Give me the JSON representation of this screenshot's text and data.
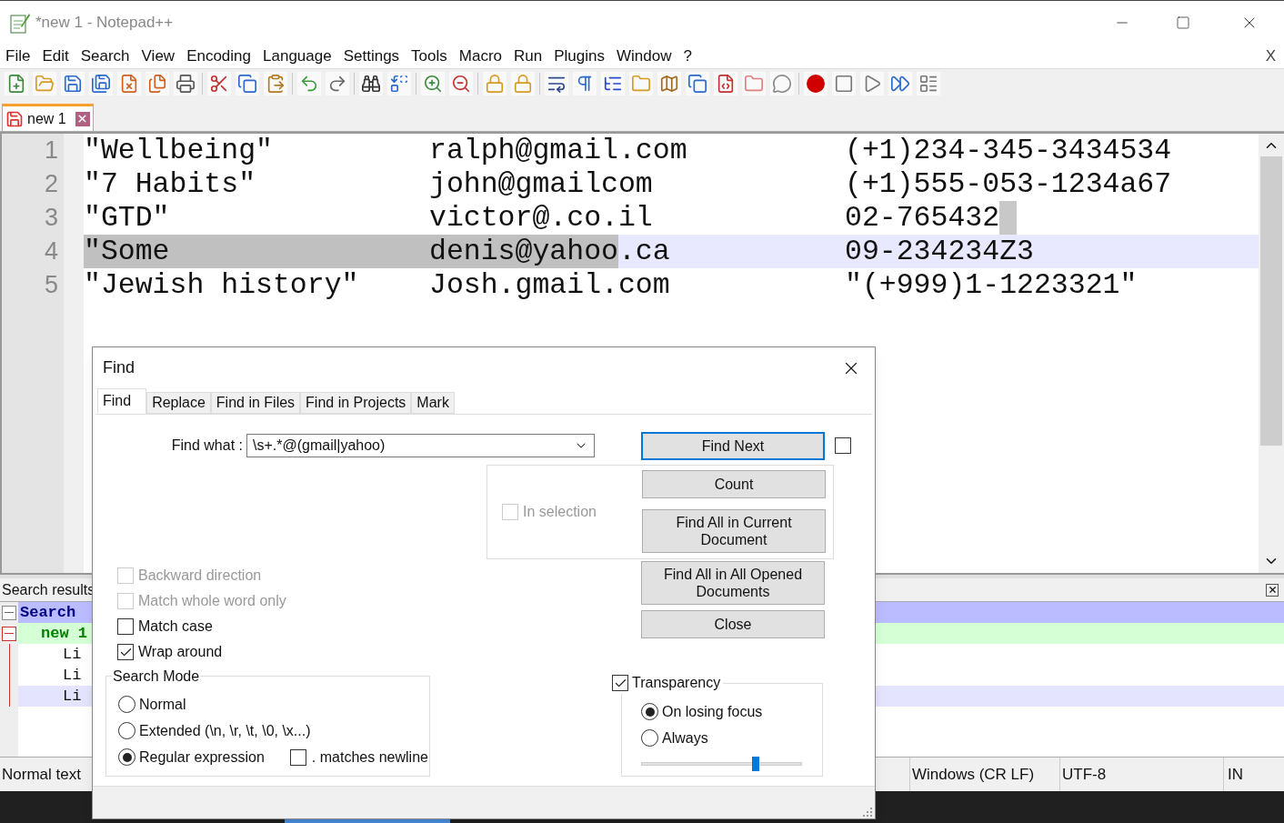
{
  "window": {
    "title": "*new 1 - Notepad++"
  },
  "menu": [
    "File",
    "Edit",
    "Search",
    "View",
    "Encoding",
    "Language",
    "Settings",
    "Tools",
    "Macro",
    "Run",
    "Plugins",
    "Window",
    "?"
  ],
  "menu_close": "X",
  "doc_tabs": [
    {
      "label": "new 1",
      "selected": true
    }
  ],
  "editor": {
    "lines": [
      {
        "number": "1",
        "current": false,
        "block_cursor": false,
        "cells": [
          [
            {
              "text": "\"Wellbeing\"",
              "selected": false
            }
          ],
          [
            {
              "text": "ralph@gmail.com",
              "selected": false
            }
          ],
          [
            {
              "text": "(+1)234-345-3434534",
              "selected": false
            }
          ]
        ]
      },
      {
        "number": "2",
        "current": false,
        "block_cursor": false,
        "cells": [
          [
            {
              "text": "\"7 Habits\"",
              "selected": false
            }
          ],
          [
            {
              "text": "john@gmailcom",
              "selected": false
            }
          ],
          [
            {
              "text": "(+1)555-053-1234a67",
              "selected": false
            }
          ]
        ]
      },
      {
        "number": "3",
        "current": false,
        "block_cursor": true,
        "cells": [
          [
            {
              "text": "\"GTD\"",
              "selected": false
            }
          ],
          [
            {
              "text": "victor@.co.il",
              "selected": false
            }
          ],
          [
            {
              "text": "02-765432",
              "selected": false
            }
          ]
        ]
      },
      {
        "number": "4",
        "current": true,
        "block_cursor": false,
        "cells": [
          [
            {
              "text": "\"Some",
              "selected": true
            }
          ],
          [
            {
              "text": "denis@yahoo",
              "selected": true
            },
            {
              "text": ".ca",
              "selected": false
            }
          ],
          [
            {
              "text": "09-234234Z3",
              "selected": false
            }
          ]
        ]
      },
      {
        "number": "5",
        "current": false,
        "block_cursor": false,
        "cells": [
          [
            {
              "text": "\"Jewish history\"",
              "selected": false
            }
          ],
          [
            {
              "text": "Josh.gmail.com",
              "selected": false
            }
          ],
          [
            {
              "text": "\"(+999)1-1223321\"",
              "selected": false
            }
          ]
        ]
      }
    ]
  },
  "search_results": {
    "title": "Search results",
    "rows": [
      {
        "kind": "search",
        "text": "Search",
        "expanded": true,
        "current": false
      },
      {
        "kind": "file",
        "text": "new 1",
        "expanded": true,
        "current": false
      },
      {
        "kind": "line",
        "text": "Li",
        "current": false
      },
      {
        "kind": "line",
        "text": "Li",
        "current": false
      },
      {
        "kind": "line",
        "text": "Li",
        "current": true
      }
    ]
  },
  "status_bar": [
    "Normal text",
    "Windows (CR LF)",
    "UTF-8",
    "IN"
  ],
  "find_dialog": {
    "title": "Find",
    "tabs": [
      {
        "label": "Find",
        "selected": true
      },
      {
        "label": "Replace",
        "selected": false
      },
      {
        "label": "Find in Files",
        "selected": false
      },
      {
        "label": "Find in Projects",
        "selected": false
      },
      {
        "label": "Mark",
        "selected": false
      }
    ],
    "find_what": {
      "label": "Find what :",
      "value": "\\s+.*@(gmail|yahoo)"
    },
    "find_next": {
      "label": "Find Next",
      "focused": true
    },
    "find_next_option": {
      "checked": false
    },
    "in_selection": {
      "label": "In selection",
      "checked": false,
      "disabled": true
    },
    "count": "Count",
    "find_all_current": "Find All in Current Document",
    "find_all_opened": "Find All in All Opened Documents",
    "close": "Close",
    "options": [
      {
        "label": "Backward direction",
        "checked": false,
        "disabled": true
      },
      {
        "label": "Match whole word only",
        "checked": false,
        "disabled": true
      },
      {
        "label": "Match case",
        "checked": false,
        "disabled": false
      },
      {
        "label": "Wrap around",
        "checked": true,
        "disabled": false
      }
    ],
    "search_mode": {
      "title": "Search Mode",
      "modes": [
        {
          "label": "Normal",
          "selected": false
        },
        {
          "label": "Extended (\\n, \\r, \\t, \\0, \\x...)",
          "selected": false
        },
        {
          "label": "Regular expression",
          "selected": true
        }
      ],
      "dot_newline": {
        "label": ". matches newline",
        "checked": false
      }
    },
    "transparency": {
      "label": "Transparency",
      "checked": true,
      "modes": [
        {
          "label": "On losing focus",
          "selected": true
        },
        {
          "label": "Always",
          "selected": false
        }
      ],
      "level": 0.71
    }
  }
}
